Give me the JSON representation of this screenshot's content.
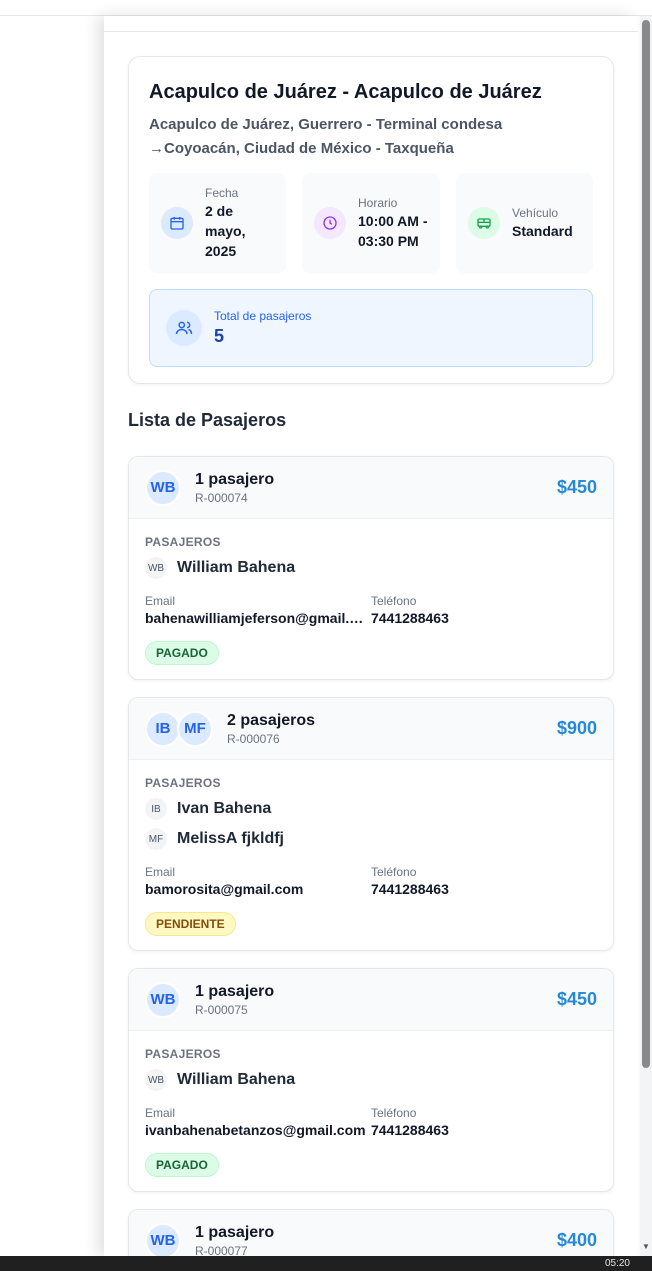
{
  "route": {
    "title": "Acapulco de Juárez - Acapulco de Juárez",
    "subtitle": "Acapulco de Juárez, Guerrero - Terminal condesa →Coyoacán, Ciudad de México - Taxqueña",
    "date_label": "Fecha",
    "date_value": "2 de mayo, 2025",
    "time_label": "Horario",
    "time_value": "10:00 AM - 03:30 PM",
    "vehicle_label": "Vehículo",
    "vehicle_value": "Standard",
    "total_label": "Total de pasajeros",
    "total_value": "5",
    "icons": [
      "calendar-icon",
      "clock-icon",
      "bus-icon",
      "users-icon"
    ]
  },
  "list_title": "Lista de Pasajeros",
  "labels": {
    "section": "PASAJEROS",
    "email": "Email",
    "phone": "Teléfono"
  },
  "reservations": [
    {
      "initials": [
        "WB"
      ],
      "count": "1 pasajero",
      "code": "R-000074",
      "price": "$450",
      "passengers": [
        {
          "initials": "WB",
          "name": "William Bahena"
        }
      ],
      "email": "bahenawilliamjeferson@gmail.co...",
      "phone": "7441288463",
      "status": "PAGADO"
    },
    {
      "initials": [
        "IB",
        "MF"
      ],
      "count": "2 pasajeros",
      "code": "R-000076",
      "price": "$900",
      "passengers": [
        {
          "initials": "IB",
          "name": "Ivan Bahena"
        },
        {
          "initials": "MF",
          "name": "MelissA fjkldfj"
        }
      ],
      "email": "bamorosita@gmail.com",
      "phone": "7441288463",
      "status": "PENDIENTE"
    },
    {
      "initials": [
        "WB"
      ],
      "count": "1 pasajero",
      "code": "R-000075",
      "price": "$450",
      "passengers": [
        {
          "initials": "WB",
          "name": "William Bahena"
        }
      ],
      "email": "ivanbahenabetanzos@gmail.com",
      "phone": "7441288463",
      "status": "PAGADO"
    },
    {
      "initials": [
        "WB"
      ],
      "count": "1 pasajero",
      "code": "R-000077",
      "price": "$400"
    }
  ],
  "colors": {
    "price": "#2589d8",
    "paid_bg": "#dcfce7",
    "pending_bg": "#fef9c3",
    "avatar_bg": "#dbeafe"
  },
  "taskbar": {
    "clock": "05:20"
  }
}
